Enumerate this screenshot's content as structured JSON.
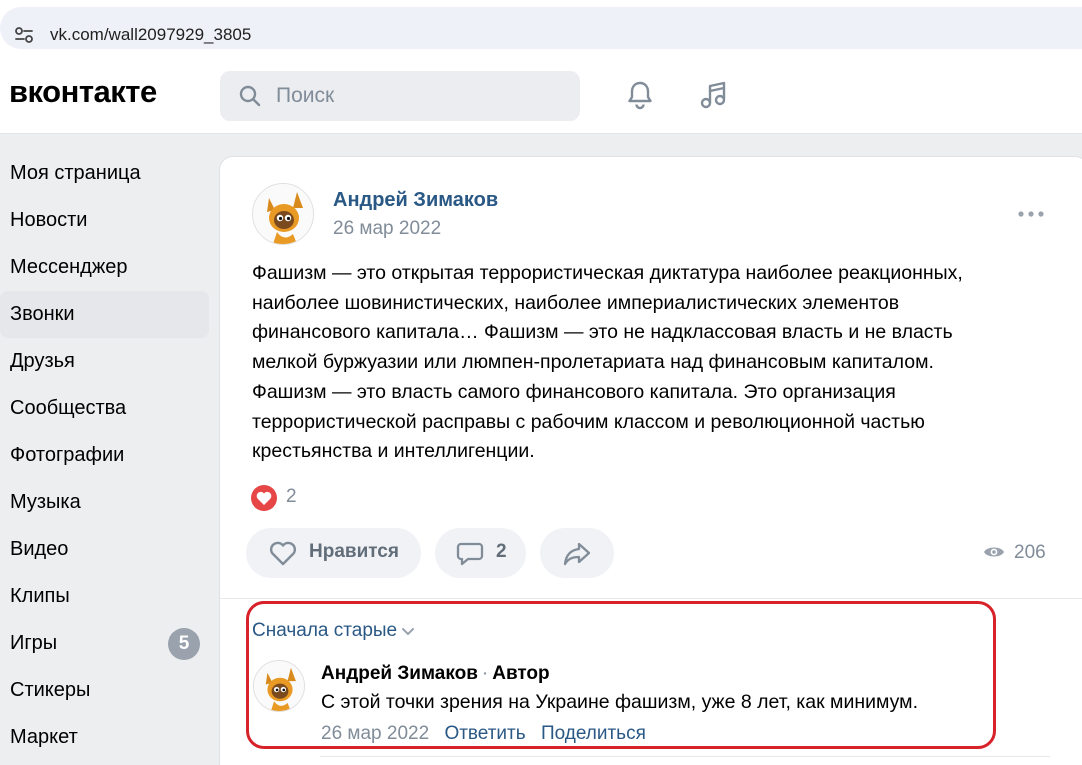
{
  "browser": {
    "url": "vk.com/wall2097929_3805"
  },
  "header": {
    "logo": "вконтакте",
    "search_placeholder": "Поиск",
    "icons": [
      "bell-icon",
      "music-icon"
    ]
  },
  "sidebar": {
    "items": [
      {
        "label": "Моя страница"
      },
      {
        "label": "Новости"
      },
      {
        "label": "Мессенджер"
      },
      {
        "label": "Звонки",
        "active": true
      },
      {
        "label": "Друзья"
      },
      {
        "label": "Сообщества"
      },
      {
        "label": "Фотографии"
      },
      {
        "label": "Музыка"
      },
      {
        "label": "Видео"
      },
      {
        "label": "Клипы"
      },
      {
        "label": "Игры",
        "badge": "5"
      },
      {
        "label": "Стикеры"
      },
      {
        "label": "Маркет"
      }
    ]
  },
  "post": {
    "author": "Андрей Зимаков",
    "date": "26 мар 2022",
    "text_lines": [
      "Фашизм — это открытая террористическая диктатура наиболее реакционных,",
      "наиболее шовинистических, наиболее империалистических элементов",
      "финансового капитала… Фашизм — это не надклассовая власть и не власть",
      "мелкой буржуазии или люмпен-пролетариата над финансовым капиталом.",
      "Фашизм — это власть самого финансового капитала. Это организация",
      "террористической расправы с рабочим классом и революционной частью",
      "крестьянства и интеллигенции."
    ],
    "reactions_count": "2",
    "like_label": "Нравится",
    "comments_count": "2",
    "views_count": "206",
    "reaction_color": "#e64646"
  },
  "comments": {
    "sort_label": "Сначала старые",
    "items": [
      {
        "author": "Андрей Зимаков",
        "separator": "·",
        "role": "Автор",
        "text": "С этой точки зрения на Украине фашизм, уже 8 лет, как минимум.",
        "date": "26 мар 2022",
        "reply_label": "Ответить",
        "share_label": "Поделиться"
      }
    ]
  },
  "colors": {
    "link": "#2a5885",
    "highlight": "#d7222a",
    "secondary_text": "#818c99"
  }
}
